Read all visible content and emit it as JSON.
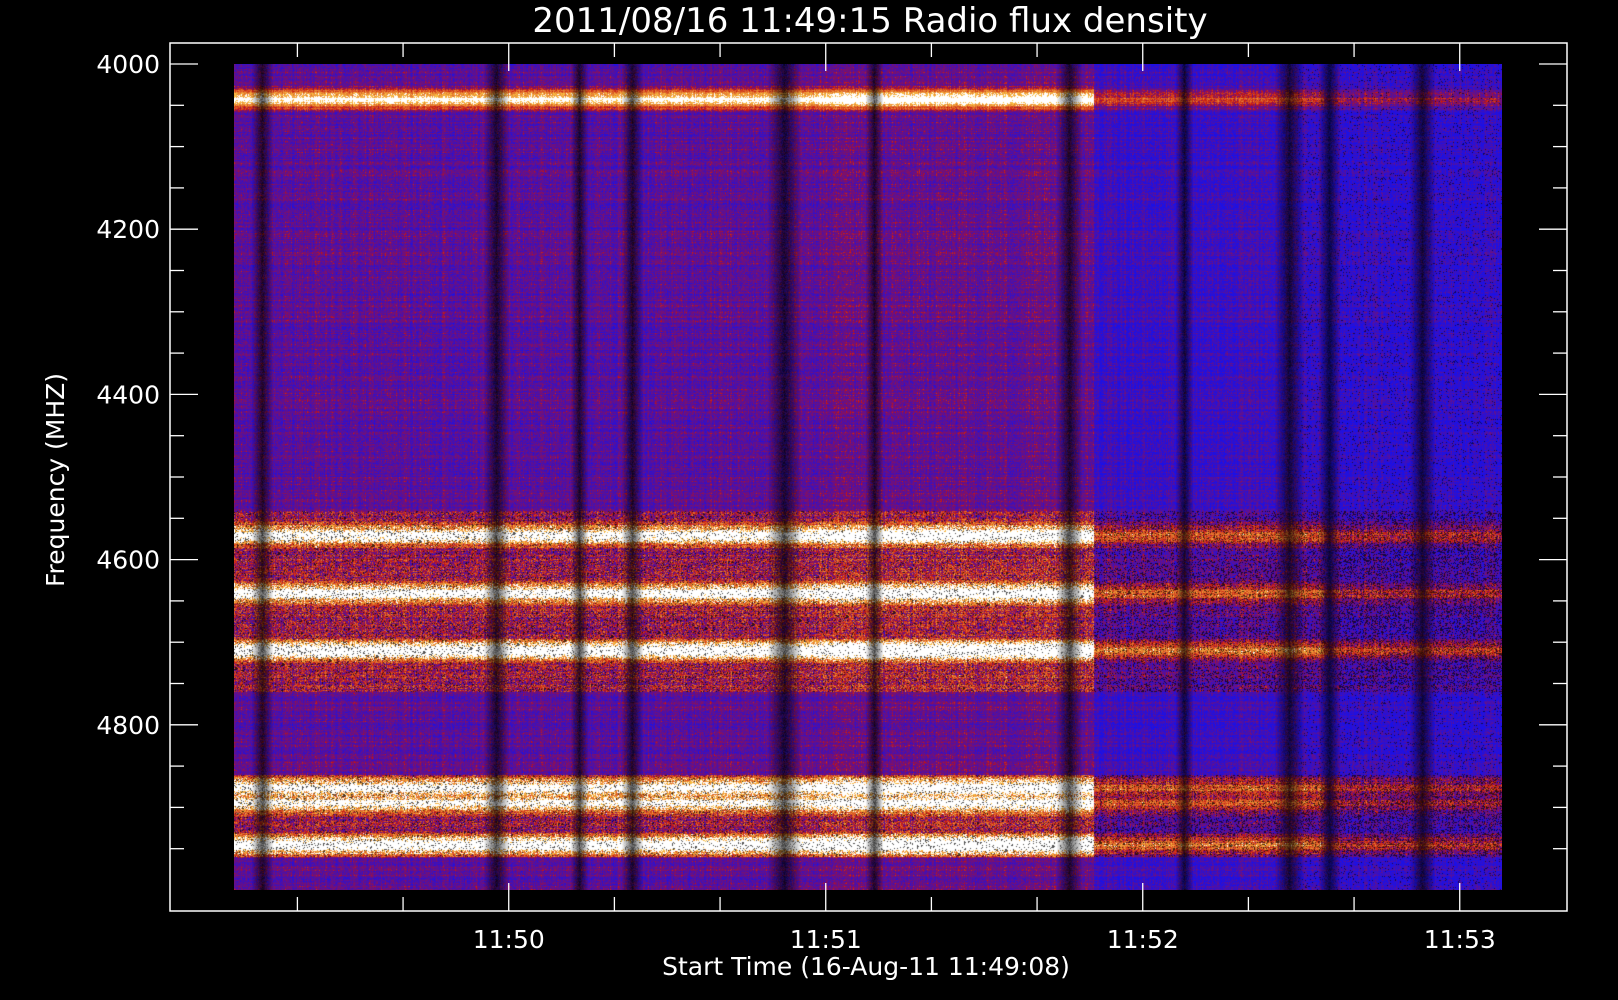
{
  "chart_data": {
    "type": "heatmap",
    "title": "2011/08/16 11:49:15 Radio flux density",
    "xlabel": "Start Time (16-Aug-11 11:49:08)",
    "ylabel": "Frequency (MHZ)",
    "x_tick_labels": [
      "11:50",
      "11:51",
      "11:52",
      "11:53"
    ],
    "y_tick_labels": [
      "4000",
      "4200",
      "4400",
      "4600",
      "4800"
    ],
    "y_ticks_mhz": [
      4000,
      4200,
      4400,
      4600,
      4800
    ],
    "y_range_mhz": [
      4000,
      5000
    ],
    "x_range": [
      "11:49:08",
      "11:53:08"
    ],
    "colors": {
      "background": "#000000",
      "axis": "#ffffff",
      "low": "#1a10e8",
      "mid": "#c41010",
      "high": "#ffd24a",
      "peak": "#ffffff"
    },
    "bright_bands_mhz": [
      {
        "center": 4042,
        "intensity": 0.9,
        "extent": "11:49:08-11:51:15"
      },
      {
        "center": 4570,
        "intensity": 0.85,
        "extent": "11:49:08-11:53:08"
      },
      {
        "center": 4640,
        "intensity": 0.9,
        "extent": "11:49:08-11:53:08"
      },
      {
        "center": 4710,
        "intensity": 1.0,
        "extent": "11:49:08-11:53:08"
      },
      {
        "center": 4876,
        "intensity": 0.85,
        "extent": "11:49:08-11:53:08"
      },
      {
        "center": 4894,
        "intensity": 0.8,
        "extent": "11:49:08-11:53:08"
      },
      {
        "center": 4945,
        "intensity": 1.0,
        "extent": "11:49:08-11:53:08"
      }
    ]
  }
}
